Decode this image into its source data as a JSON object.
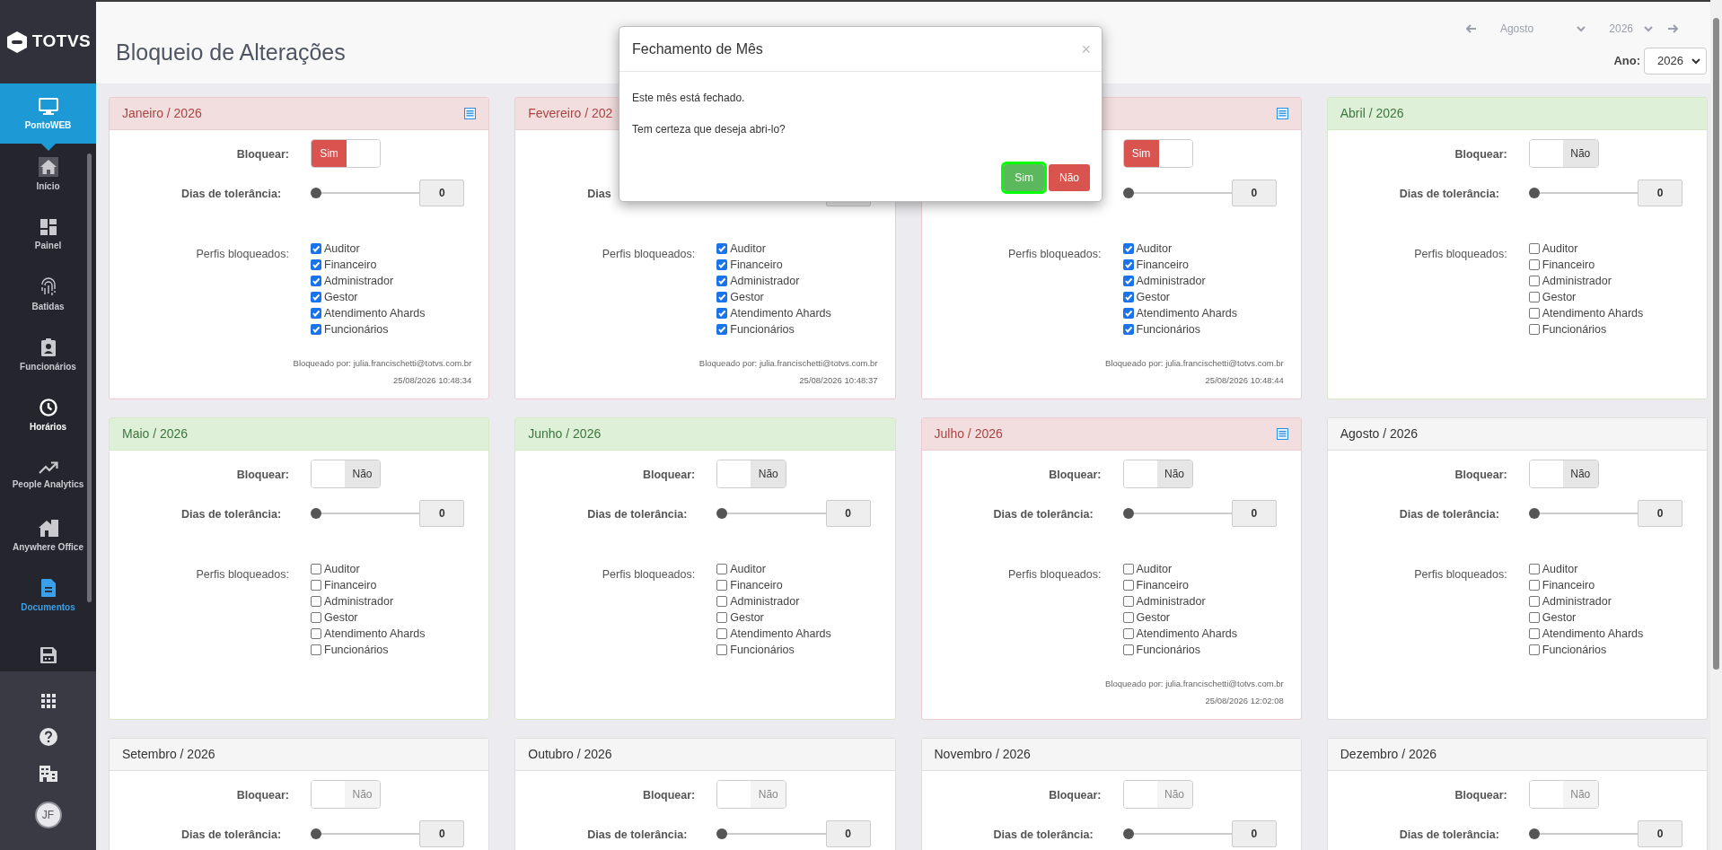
{
  "sidebar": {
    "logo": "TOTVS",
    "items": [
      {
        "label": "PontoWEB",
        "selected": true,
        "kind": "app"
      },
      {
        "label": "Início",
        "selected": false,
        "kind": "plain"
      },
      {
        "label": "Painel",
        "selected": false,
        "kind": "plain"
      },
      {
        "label": "Batidas",
        "selected": false,
        "kind": "plain"
      },
      {
        "label": "Funcionários",
        "selected": false,
        "kind": "plain"
      },
      {
        "label": "Horários",
        "selected": false,
        "kind": "bright"
      },
      {
        "label": "People Analytics",
        "selected": false,
        "kind": "plain"
      },
      {
        "label": "Anywhere Office",
        "selected": false,
        "kind": "plain"
      },
      {
        "label": "Documentos",
        "selected": false,
        "kind": "accent"
      },
      {
        "selected": false,
        "kind": "plain"
      }
    ],
    "avatar": "JF"
  },
  "page": {
    "title": "Bloqueio de Alterações",
    "month": "Agosto",
    "year": "2026",
    "year_label": "Ano:",
    "year_select": "2026"
  },
  "cards": [
    {
      "title": "Janeiro / 2026",
      "kind": "closed",
      "report_icon": true,
      "lock_label": "Bloquear:",
      "toggle": {
        "text": "Sim",
        "on": true,
        "disabled": false
      },
      "tolerance": {
        "label": "Dias de tolerância:",
        "level": 0,
        "value": "0"
      },
      "profiles_label": "Perfis bloqueados:",
      "profiles": [
        {
          "label": "Auditor",
          "checked": true
        },
        {
          "label": "Financeiro",
          "checked": true
        },
        {
          "label": "Administrador",
          "checked": true
        },
        {
          "label": "Gestor",
          "checked": true
        },
        {
          "label": "Atendimento Ahards",
          "checked": true
        },
        {
          "label": "Funcionários",
          "checked": true
        }
      ],
      "blocked_by": "Bloqueado por: julia.francischetti@totvs.com.br",
      "blocked_at": "25/08/2026 10:48:34"
    },
    {
      "title": "Fevereiro / 202",
      "kind": "closed",
      "report_icon": false,
      "tolerance": {
        "label": "Dias"
      },
      "profiles_label": "Perfis bloqueados:",
      "profiles": [
        {
          "label": "Auditor",
          "checked": true
        },
        {
          "label": "Financeiro",
          "checked": true
        },
        {
          "label": "Administrador",
          "checked": true
        },
        {
          "label": "Gestor",
          "checked": true
        },
        {
          "label": "Atendimento Ahards",
          "checked": true
        },
        {
          "label": "Funcionários",
          "checked": true
        }
      ],
      "blocked_by": "Bloqueado por: julia.francischetti@totvs.com.br",
      "blocked_at": "25/08/2026 10:48:37"
    },
    {
      "kind": "closed",
      "report_icon": true,
      "toggle": {
        "text": "Sim",
        "on": true,
        "disabled": false
      },
      "tolerance": {
        "level": 0,
        "value": "0"
      },
      "profiles_label": "Perfis bloqueados:",
      "profiles": [
        {
          "label": "Auditor",
          "checked": true
        },
        {
          "label": "Financeiro",
          "checked": true
        },
        {
          "label": "Administrador",
          "checked": true
        },
        {
          "label": "Gestor",
          "checked": true
        },
        {
          "label": "Atendimento Ahards",
          "checked": true
        },
        {
          "label": "Funcionários",
          "checked": true
        }
      ],
      "blocked_by": "Bloqueado por: julia.francischetti@totvs.com.br",
      "blocked_at": "25/08/2026 10:48:44"
    },
    {
      "title": "Abril / 2026",
      "kind": "open",
      "report_icon": false,
      "lock_label": "Bloquear:",
      "toggle": {
        "text": "Não",
        "on": false,
        "disabled": false
      },
      "tolerance": {
        "label": "Dias de tolerância:",
        "level": 0,
        "value": "0"
      },
      "profiles_label": "Perfis bloqueados:",
      "profiles": [
        {
          "label": "Auditor",
          "checked": false
        },
        {
          "label": "Financeiro",
          "checked": false
        },
        {
          "label": "Administrador",
          "checked": false
        },
        {
          "label": "Gestor",
          "checked": false
        },
        {
          "label": "Atendimento Ahards",
          "checked": false
        },
        {
          "label": "Funcionários",
          "checked": false
        }
      ]
    },
    {
      "title": "Maio / 2026",
      "kind": "open",
      "report_icon": false,
      "lock_label": "Bloquear:",
      "toggle": {
        "text": "Não",
        "on": false,
        "disabled": false
      },
      "tolerance": {
        "label": "Dias de tolerância:",
        "level": 0,
        "value": "0"
      },
      "profiles_label": "Perfis bloqueados:",
      "profiles": [
        {
          "label": "Auditor",
          "checked": false
        },
        {
          "label": "Financeiro",
          "checked": false
        },
        {
          "label": "Administrador",
          "checked": false
        },
        {
          "label": "Gestor",
          "checked": false
        },
        {
          "label": "Atendimento Ahards",
          "checked": false
        },
        {
          "label": "Funcionários",
          "checked": false
        }
      ]
    },
    {
      "title": "Junho / 2026",
      "kind": "open",
      "report_icon": false,
      "lock_label": "Bloquear:",
      "toggle": {
        "text": "Não",
        "on": false,
        "disabled": false
      },
      "tolerance": {
        "label": "Dias de tolerância:",
        "level": 0,
        "value": "0"
      },
      "profiles_label": "Perfis bloqueados:",
      "profiles": [
        {
          "label": "Auditor",
          "checked": false
        },
        {
          "label": "Financeiro",
          "checked": false
        },
        {
          "label": "Administrador",
          "checked": false
        },
        {
          "label": "Gestor",
          "checked": false
        },
        {
          "label": "Atendimento Ahards",
          "checked": false
        },
        {
          "label": "Funcionários",
          "checked": false
        }
      ]
    },
    {
      "title": "Julho / 2026",
      "kind": "closed",
      "report_icon": true,
      "lock_label": "Bloquear:",
      "toggle": {
        "text": "Não",
        "on": false,
        "disabled": false
      },
      "tolerance": {
        "label": "Dias de tolerância:",
        "level": 0,
        "value": "0"
      },
      "profiles_label": "Perfis bloqueados:",
      "profiles": [
        {
          "label": "Auditor",
          "checked": false
        },
        {
          "label": "Financeiro",
          "checked": false
        },
        {
          "label": "Administrador",
          "checked": false
        },
        {
          "label": "Gestor",
          "checked": false
        },
        {
          "label": "Atendimento Ahards",
          "checked": false
        },
        {
          "label": "Funcionários",
          "checked": false
        }
      ],
      "blocked_by": "Bloqueado por: julia.francischetti@totvs.com.br",
      "blocked_at": "25/08/2026 12:02:08"
    },
    {
      "title": "Agosto / 2026",
      "kind": "default",
      "report_icon": false,
      "lock_label": "Bloquear:",
      "toggle": {
        "text": "Não",
        "on": false,
        "disabled": false
      },
      "tolerance": {
        "label": "Dias de tolerância:",
        "level": 0,
        "value": "0"
      },
      "profiles_label": "Perfis bloqueados:",
      "profiles": [
        {
          "label": "Auditor",
          "checked": false
        },
        {
          "label": "Financeiro",
          "checked": false
        },
        {
          "label": "Administrador",
          "checked": false
        },
        {
          "label": "Gestor",
          "checked": false
        },
        {
          "label": "Atendimento Ahards",
          "checked": false
        },
        {
          "label": "Funcionários",
          "checked": false
        }
      ]
    },
    {
      "title": "Setembro / 2026",
      "kind": "default",
      "report_icon": false,
      "lock_label": "Bloquear:",
      "toggle": {
        "text": "Não",
        "on": false,
        "disabled": true
      },
      "tolerance": {
        "label": "Dias de tolerância:",
        "level": 0,
        "value": "0"
      }
    },
    {
      "title": "Outubro / 2026",
      "kind": "default",
      "report_icon": false,
      "lock_label": "Bloquear:",
      "toggle": {
        "text": "Não",
        "on": false,
        "disabled": true
      },
      "tolerance": {
        "label": "Dias de tolerância:",
        "level": 0,
        "value": "0"
      }
    },
    {
      "title": "Novembro / 2026",
      "kind": "default",
      "report_icon": false,
      "lock_label": "Bloquear:",
      "toggle": {
        "text": "Não",
        "on": false,
        "disabled": true
      },
      "tolerance": {
        "label": "Dias de tolerância:",
        "level": 0,
        "value": "0"
      }
    },
    {
      "title": "Dezembro / 2026",
      "kind": "default",
      "report_icon": false,
      "lock_label": "Bloquear:",
      "toggle": {
        "text": "Não",
        "on": false,
        "disabled": true
      },
      "tolerance": {
        "label": "Dias de tolerância:",
        "level": 0,
        "value": "0"
      }
    }
  ],
  "dialog": {
    "title": "Fechamento de Mês",
    "close": "×",
    "lines": [
      "Este mês está fechado.",
      "Tem certeza que deseja abri-lo?"
    ],
    "buttons": [
      {
        "label": "Sim",
        "kind": "confirm",
        "focused": true
      },
      {
        "label": "Não",
        "kind": "cancel",
        "focused": false
      }
    ]
  }
}
